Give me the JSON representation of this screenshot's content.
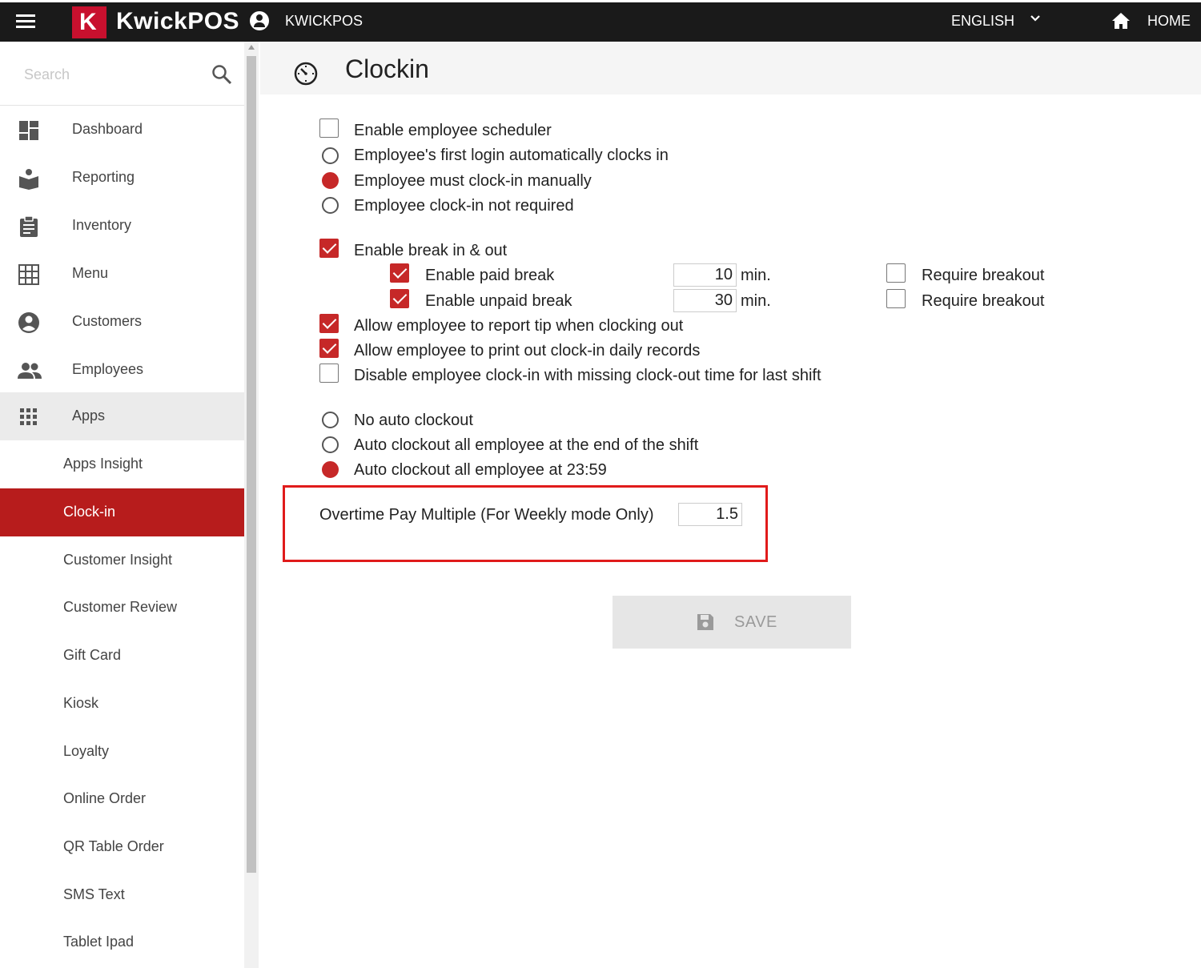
{
  "topbar": {
    "logo_letter": "K",
    "logo_text": "KwickPOS",
    "account_name": "KWICKPOS",
    "language": "ENGLISH",
    "home_label": "HOME"
  },
  "sidebar": {
    "search_placeholder": "Search",
    "nav": [
      {
        "label": "Dashboard",
        "icon": "dashboard-icon"
      },
      {
        "label": "Reporting",
        "icon": "reporting-icon"
      },
      {
        "label": "Inventory",
        "icon": "clipboard-icon"
      },
      {
        "label": "Menu",
        "icon": "grid-icon"
      },
      {
        "label": "Customers",
        "icon": "account-circle-icon"
      },
      {
        "label": "Employees",
        "icon": "people-icon"
      },
      {
        "label": "Apps",
        "icon": "apps-icon"
      }
    ],
    "apps_sub": [
      "Apps Insight",
      "Clock-in",
      "Customer Insight",
      "Customer Review",
      "Gift Card",
      "Kiosk",
      "Loyalty",
      "Online Order",
      "QR Table Order",
      "SMS Text",
      "Tablet Ipad"
    ],
    "active_sub": "Clock-in"
  },
  "page": {
    "title": "Clockin",
    "options": {
      "enable_scheduler": {
        "label": "Enable employee scheduler",
        "checked": false
      },
      "clockin_mode": {
        "options": [
          "Employee's first login automatically clocks in",
          "Employee must clock-in manually",
          "Employee clock-in not required"
        ],
        "selected": "Employee must clock-in manually"
      },
      "enable_break": {
        "label": "Enable break in & out",
        "checked": true
      },
      "paid_break": {
        "label": "Enable paid break",
        "checked": true,
        "minutes": "10",
        "unit": "min.",
        "require_label": "Require breakout",
        "require_checked": false
      },
      "unpaid_break": {
        "label": "Enable unpaid break",
        "checked": true,
        "minutes": "30",
        "unit": "min.",
        "require_label": "Require breakout",
        "require_checked": false
      },
      "report_tip": {
        "label": "Allow employee to report tip when clocking out",
        "checked": true
      },
      "print_records": {
        "label": "Allow employee to print out clock-in daily records",
        "checked": true
      },
      "disable_missing": {
        "label": "Disable employee clock-in with missing clock-out time for last shift",
        "checked": false
      },
      "auto_clockout": {
        "options": [
          "No auto clockout",
          "Auto clockout all employee at the end of the shift",
          "Auto clockout all employee at 23:59"
        ],
        "selected": "Auto clockout all employee at 23:59"
      },
      "overtime": {
        "label": "Overtime Pay Multiple (For Weekly mode Only)",
        "value": "1.5"
      }
    },
    "save_label": "SAVE"
  },
  "colors": {
    "accent": "#c62828",
    "active_nav": "#b71c1c",
    "highlight_box": "#e01b1b",
    "topbar": "#1a1a1a"
  }
}
